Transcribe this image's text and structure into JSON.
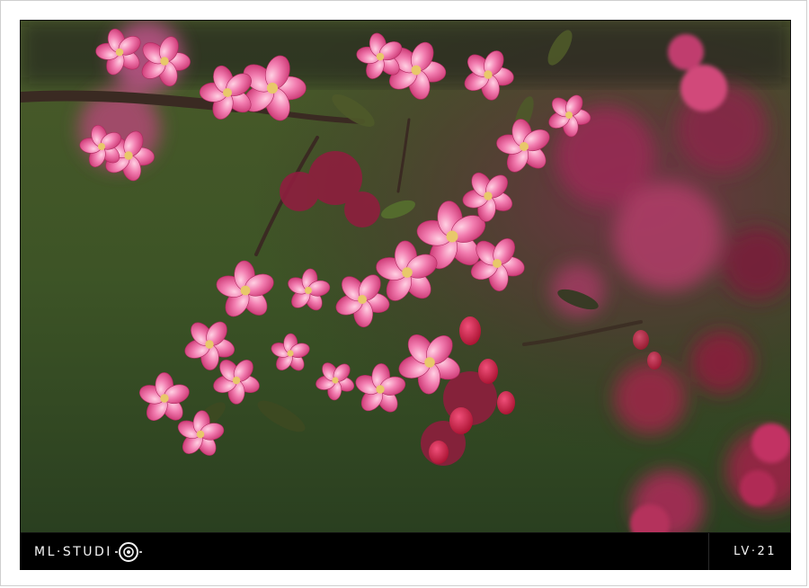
{
  "footer": {
    "brand_text": "ML·STUDI",
    "brand_logo_icon": "camera-lens-icon",
    "code": "LV·21"
  },
  "colors": {
    "background_top": "#5a6a2a",
    "background_bottom": "#2c4222",
    "petal_pink": "#e8559a",
    "petal_light": "#f6a8c8",
    "bud_red": "#c0143c",
    "footer_bg": "#000000",
    "frame_bg": "#ffffff"
  }
}
